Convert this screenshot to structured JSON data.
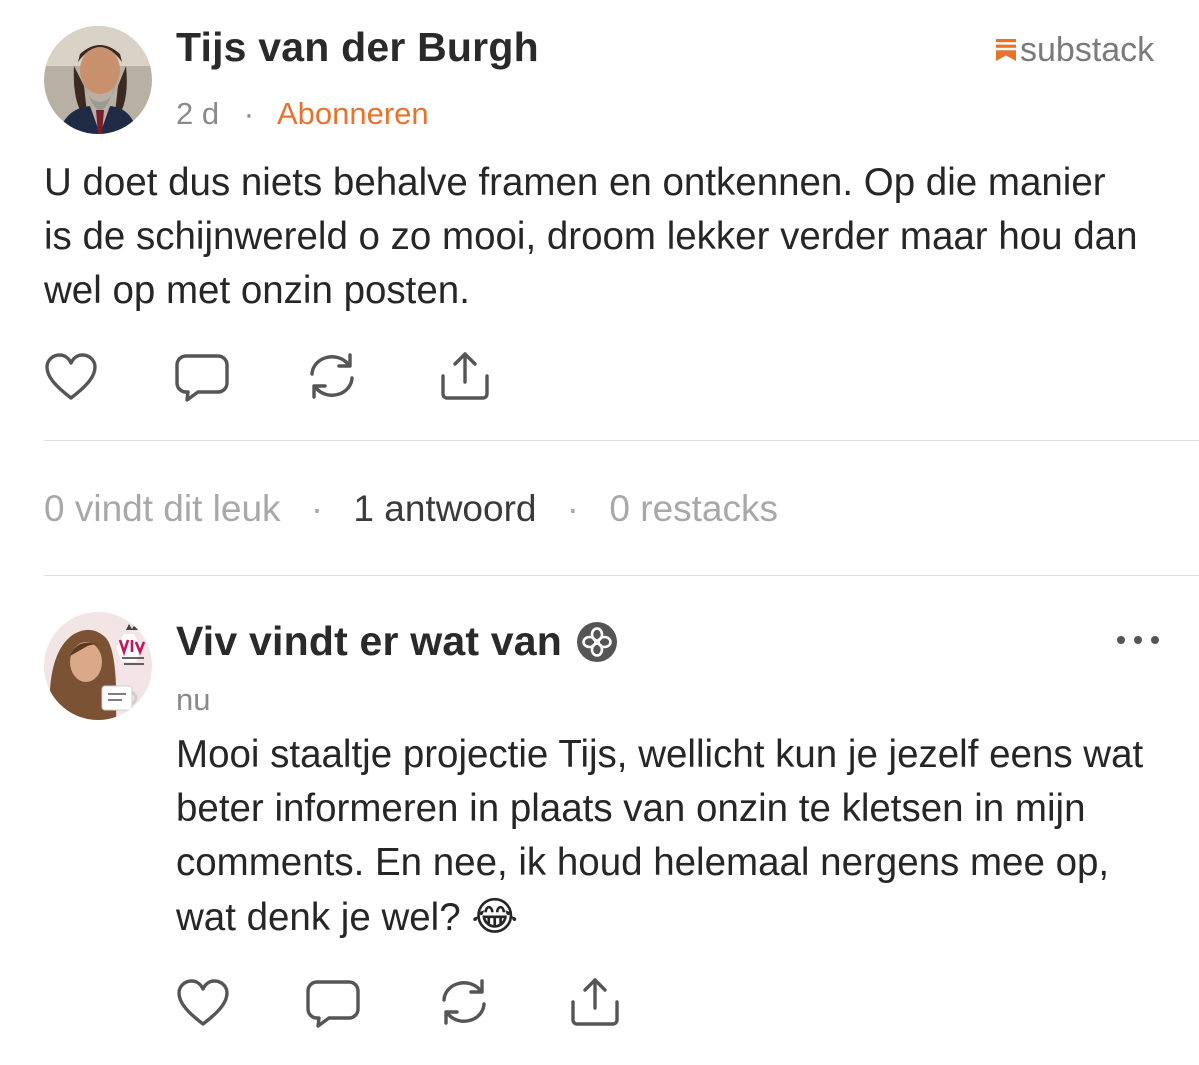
{
  "brand": {
    "label": "substack",
    "color": "#e8732f"
  },
  "post": {
    "author": "Tijs van der Burgh",
    "time": "2 d",
    "separator": "·",
    "subscribe_label": "Abonneren",
    "text": "U doet dus niets behalve framen en ontkennen. Op die manier is de schijnwereld o zo mooi, droom lekker verder maar hou dan wel op met onzin posten.",
    "actions": [
      "heart-icon",
      "comment-icon",
      "restack-icon",
      "share-icon"
    ]
  },
  "stats": {
    "likes": "0 vindt dit leuk",
    "replies": "1 antwoord",
    "restacks": "0 restacks",
    "separator": "·"
  },
  "reply": {
    "author": "Viv vindt er wat van",
    "time": "nu",
    "text": "Mooi staaltje projectie Tijs, wellicht kun je jezelf eens wat beter informeren in plaats van onzin te kletsen in mijn comments. En nee, ik houd helemaal nergens mee op, wat denk je wel?",
    "emoji": "😂",
    "more_icon": "ellipsis-icon",
    "badge_icon": "badge-icon",
    "actions": [
      "heart-icon",
      "comment-icon",
      "restack-icon",
      "share-icon"
    ]
  }
}
